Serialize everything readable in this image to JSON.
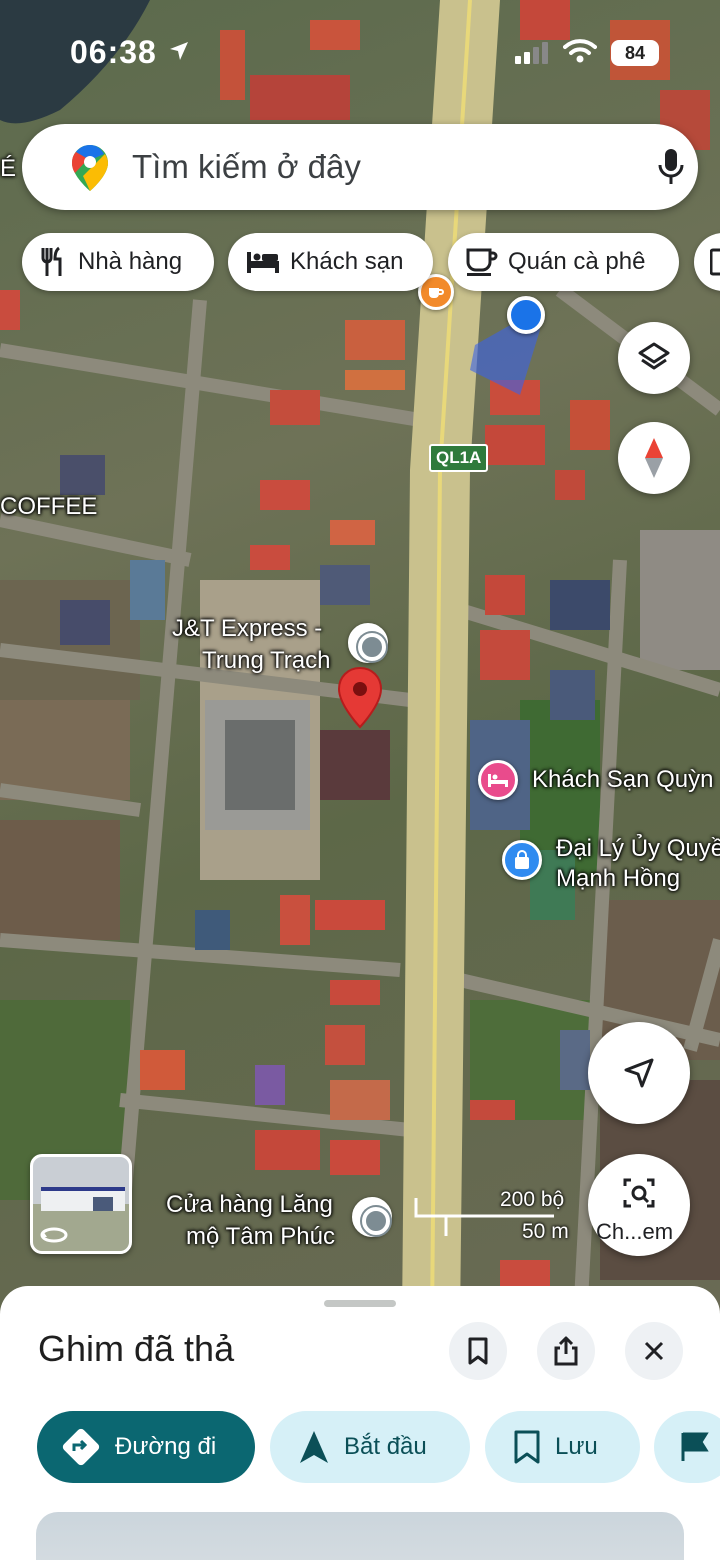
{
  "status_bar": {
    "time": "06:38",
    "battery": "84"
  },
  "search": {
    "placeholder": "Tìm kiếm ở đây"
  },
  "chips": [
    {
      "label": "Nhà hàng",
      "icon": "fork-knife-icon"
    },
    {
      "label": "Khách sạn",
      "icon": "bed-icon"
    },
    {
      "label": "Quán cà phê",
      "icon": "coffee-cup-icon"
    }
  ],
  "map": {
    "road_badge": "QL1A",
    "labels": {
      "coffee_partial": "COFFEE",
      "left_edge_partial": "É",
      "jt_express_line1": "J&T Express -",
      "jt_express_line2": "Trung Trạch",
      "hotel": "Khách Sạn Quỳn",
      "agency_line1": "Đại Lý Ủy Quyề",
      "agency_line2": "Mạnh Hồng",
      "shop_line1": "Cửa hàng Lăng",
      "shop_line2": "mộ Tâm Phúc"
    },
    "scale": {
      "imperial": "200 bộ",
      "metric": "50 m"
    },
    "street_view_label": "Ch...em"
  },
  "sheet": {
    "title": "Ghim đã thả",
    "actions": [
      {
        "label": "Đường đi",
        "icon": "directions-icon"
      },
      {
        "label": "Bắt đầu",
        "icon": "navigation-arrow-icon"
      },
      {
        "label": "Lưu",
        "icon": "bookmark-icon"
      }
    ]
  },
  "colors": {
    "primary_action": "#0b6771",
    "secondary_action": "#d6f0f7",
    "pin": "#e53935",
    "location_dot": "#1a73e8"
  }
}
